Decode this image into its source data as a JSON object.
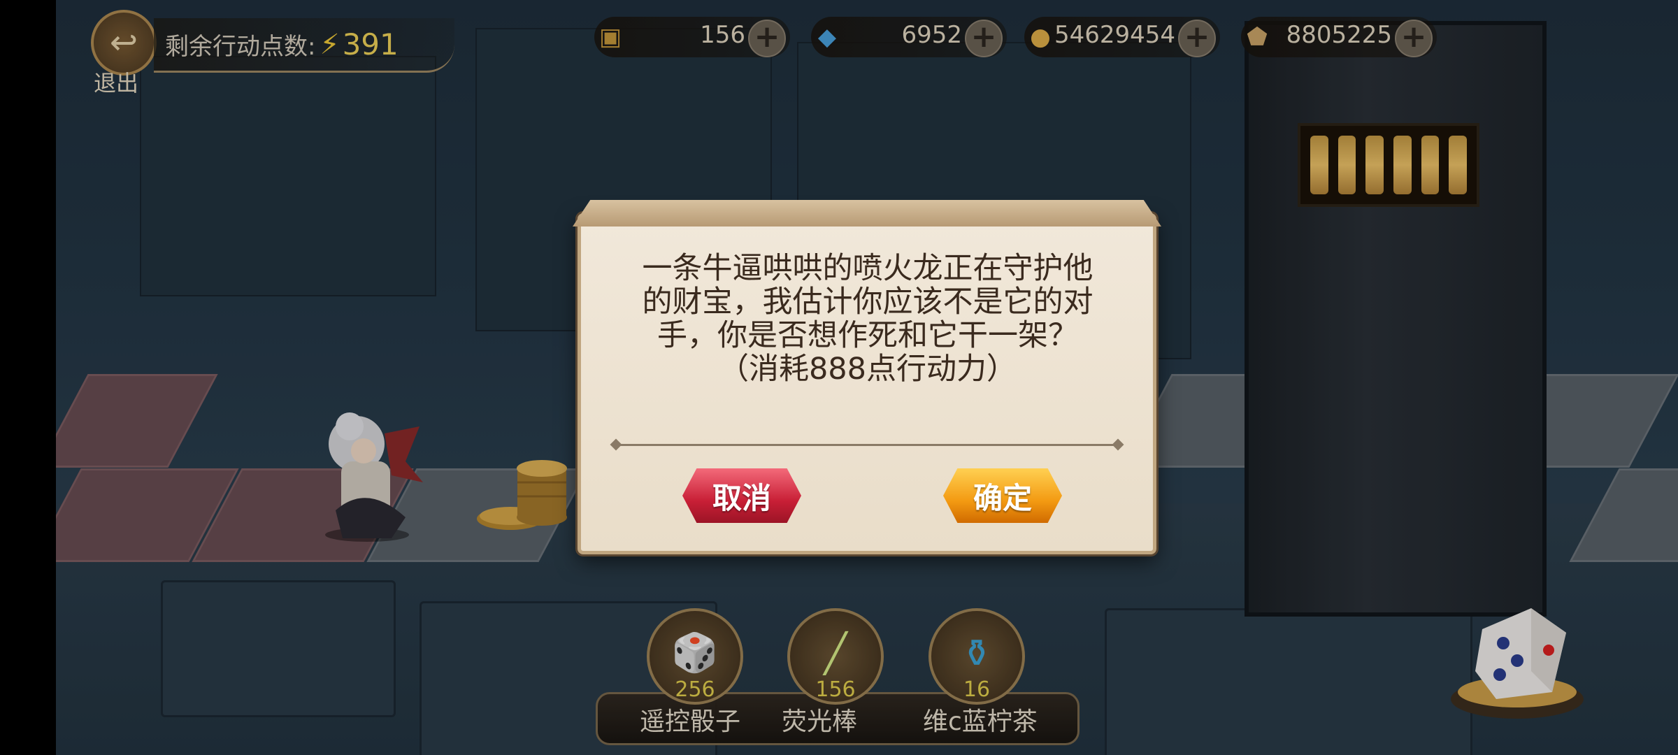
{
  "hud": {
    "exit_label": "退出",
    "action_points_label": "剩余行动点数:",
    "action_points_value": "391",
    "resources": [
      {
        "icon": "treasure-chest-icon",
        "value": "156"
      },
      {
        "icon": "blue-card-icon",
        "value": "6952"
      },
      {
        "icon": "gold-coin-icon",
        "value": "54629454"
      },
      {
        "icon": "crystal-icon",
        "value": "8805225"
      }
    ]
  },
  "dialog": {
    "message": "一条牛逼哄哄的喷火龙正在守护他的财宝，我估计你应该不是它的对手，你是否想作死和它干一架？（消耗888点行动力）",
    "cancel_label": "取消",
    "confirm_label": "确定"
  },
  "items": [
    {
      "icon": "remote-dice-icon",
      "count": "256",
      "label": "遥控骰子"
    },
    {
      "icon": "glow-stick-icon",
      "count": "156",
      "label": "荧光棒"
    },
    {
      "icon": "tea-bottle-icon",
      "count": "16",
      "label": "维c蓝柠茶"
    }
  ],
  "colors": {
    "cancel_button": "#c81f36",
    "confirm_button": "#f39a12",
    "action_points": "#f2d55a"
  }
}
